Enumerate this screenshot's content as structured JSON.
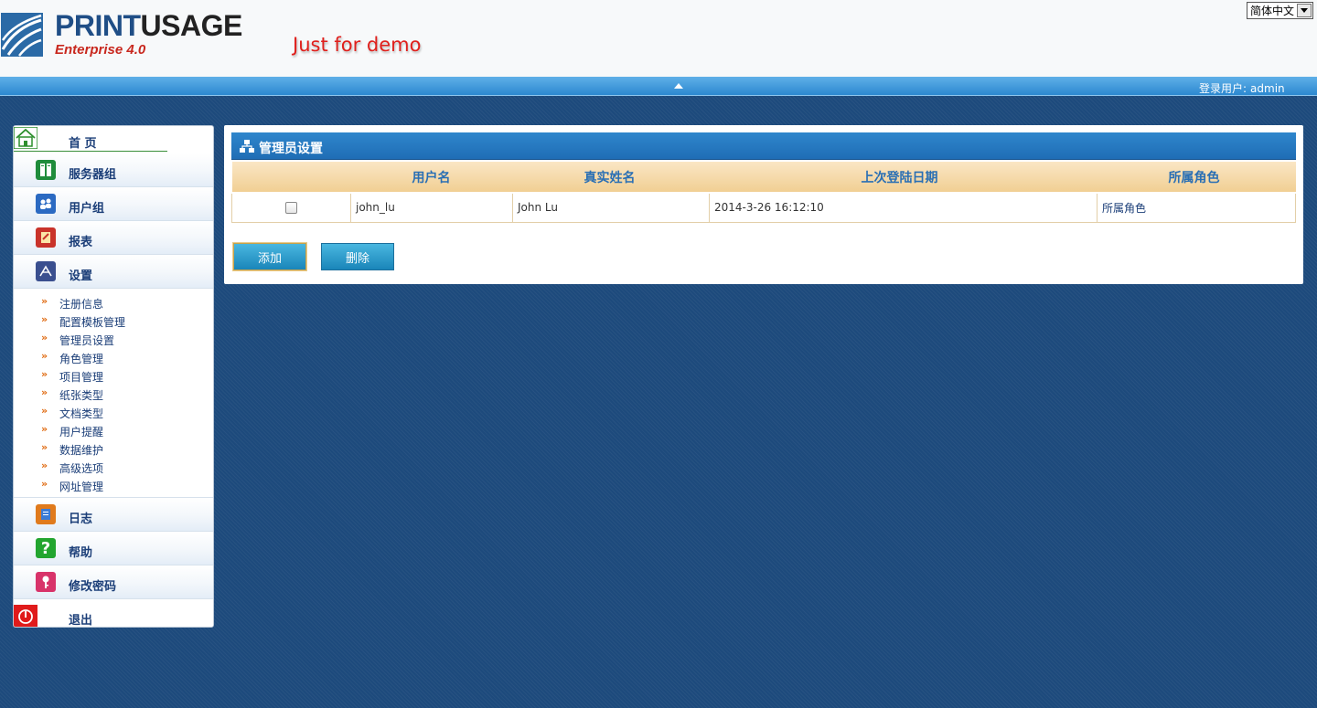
{
  "header": {
    "logo_print": "PRINT",
    "logo_usage": "USAGE",
    "logo_sub": "Enterprise 4.0",
    "demo_note": "Just for demo",
    "language": "简体中文"
  },
  "topbar": {
    "login_label": "登录用户:",
    "login_user": "admin"
  },
  "sidebar": {
    "items": [
      {
        "label": "首 页",
        "icon": "home-icon"
      },
      {
        "label": "服务器组",
        "icon": "server-group-icon"
      },
      {
        "label": "用户组",
        "icon": "user-group-icon"
      },
      {
        "label": "报表",
        "icon": "report-icon"
      },
      {
        "label": "设置",
        "icon": "settings-icon"
      }
    ],
    "settings_sub": [
      "注册信息",
      "配置模板管理",
      "管理员设置",
      "角色管理",
      "项目管理",
      "纸张类型",
      "文档类型",
      "用户提醒",
      "数据维护",
      "高级选项",
      "网址管理"
    ],
    "bottom_items": [
      {
        "label": "日志",
        "icon": "log-icon"
      },
      {
        "label": "帮助",
        "icon": "help-icon"
      },
      {
        "label": "修改密码",
        "icon": "key-icon"
      },
      {
        "label": "退出",
        "icon": "power-icon"
      }
    ]
  },
  "main": {
    "title": "管理员设置",
    "columns": [
      "用户名",
      "真实姓名",
      "上次登陆日期",
      "所属角色"
    ],
    "rows": [
      {
        "username": "john_lu",
        "realname": "John Lu",
        "last_login": "2014-3-26 16:12:10",
        "role": "所属角色"
      }
    ],
    "add_label": "添加",
    "delete_label": "删除"
  },
  "colors": {
    "background": "#1d4a7c",
    "accent": "#2f86cc",
    "header_row": "#f1cf93"
  }
}
